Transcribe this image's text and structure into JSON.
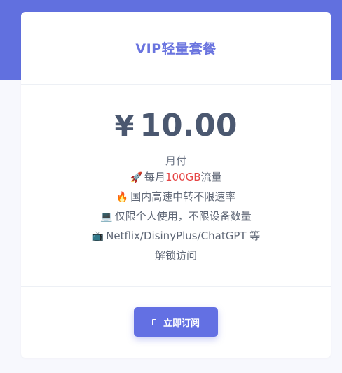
{
  "plan": {
    "title": "VIP轻量套餐",
    "currency_symbol": "¥",
    "price": "10.00",
    "period": "月付",
    "features": [
      {
        "icon": "rocket-icon",
        "emoji": "🚀",
        "before": "每月",
        "highlight": "100GB",
        "after": "流量"
      },
      {
        "icon": "fire-icon",
        "emoji": "🔥",
        "before": "国内高速中转不限速率",
        "highlight": "",
        "after": ""
      },
      {
        "icon": "laptop-icon",
        "emoji": "💻",
        "before": "仅限个人使用，不限设备数量",
        "highlight": "",
        "after": ""
      },
      {
        "icon": "tv-icon",
        "emoji": "📺",
        "before": "Netflix/DisinyPlus/ChatGPT 等",
        "highlight": "",
        "after": ""
      },
      {
        "icon": "",
        "emoji": "",
        "before": "解锁访问",
        "highlight": "",
        "after": ""
      }
    ],
    "subscribe_label": "立即订阅"
  },
  "colors": {
    "accent": "#6170df",
    "highlight": "#e64545",
    "price_text": "#4b5870"
  }
}
